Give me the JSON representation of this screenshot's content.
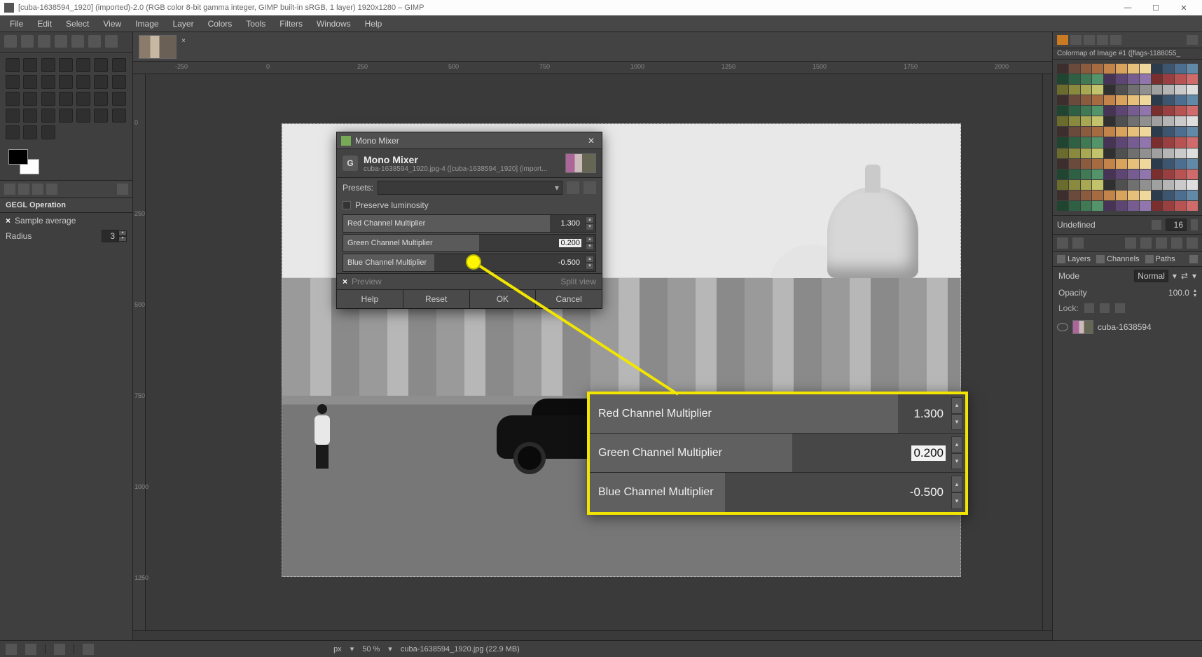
{
  "title": "[cuba-1638594_1920] (imported)-2.0 (RGB color 8-bit gamma integer, GIMP built-in sRGB, 1 layer) 1920x1280 – GIMP",
  "menu": [
    "File",
    "Edit",
    "Select",
    "View",
    "Image",
    "Layer",
    "Colors",
    "Tools",
    "Filters",
    "Windows",
    "Help"
  ],
  "gegl": {
    "header": "GEGL Operation",
    "sample": "Sample average",
    "radius_label": "Radius",
    "radius_value": "3"
  },
  "colormap": {
    "header": "Colormap of Image #1 ([flags-1188055_",
    "undef": "Undefined",
    "idx": "16"
  },
  "layers_panel": {
    "tabs": [
      "Layers",
      "Channels",
      "Paths"
    ],
    "mode_label": "Mode",
    "mode_value": "Normal",
    "opacity_label": "Opacity",
    "opacity_value": "100.0",
    "lock_label": "Lock:",
    "layer_name": "cuba-1638594"
  },
  "ruler_h": [
    "-250",
    "0",
    "250",
    "500",
    "750",
    "1000",
    "1250",
    "1500",
    "1750",
    "2000"
  ],
  "ruler_v": [
    "0",
    "250",
    "500",
    "750",
    "1000",
    "1250"
  ],
  "status": {
    "unit": "px",
    "zoom": "50 %",
    "file": "cuba-1638594_1920.jpg (22.9 MB)"
  },
  "dialog": {
    "wintitle": "Mono Mixer",
    "title": "Mono Mixer",
    "subtitle": "cuba-1638594_1920.jpg-4 ([cuba-1638594_1920] (import...",
    "presets": "Presets:",
    "preserve": "Preserve luminosity",
    "red_label": "Red Channel Multiplier",
    "red_value": "1.300",
    "green_label": "Green Channel Multiplier",
    "green_value": "0.200",
    "blue_label": "Blue Channel Multiplier",
    "blue_value": "-0.500",
    "preview": "Preview",
    "splitview": "Split view",
    "help": "Help",
    "reset": "Reset",
    "ok": "OK",
    "cancel": "Cancel"
  },
  "callout": {
    "red_label": "Red Channel Multiplier",
    "red_value": "1.300",
    "green_label": "Green Channel Multiplier",
    "green_value": "0.200",
    "blue_label": "Blue Channel Multiplier",
    "blue_value": "-0.500"
  },
  "colors": [
    "#3b2e2c",
    "#6a4a3a",
    "#8c5a3d",
    "#a76b42",
    "#c28448",
    "#d8a45d",
    "#e6c07a",
    "#f0d89c",
    "#2c3b4d",
    "#3d5670",
    "#4e6e8f",
    "#6389a9",
    "#1f4430",
    "#2e6043",
    "#3f7a55",
    "#54946a",
    "#473355",
    "#5d4673",
    "#765c91",
    "#9076ad",
    "#7a2e2e",
    "#9a3f3f",
    "#b85353",
    "#d06b6b",
    "#6b6b2e",
    "#8a8a3f",
    "#a8a853",
    "#c3c36b",
    "#303030",
    "#505050",
    "#707070",
    "#909090",
    "#a0a0a0",
    "#b5b5b5",
    "#cacaca",
    "#dedede"
  ]
}
